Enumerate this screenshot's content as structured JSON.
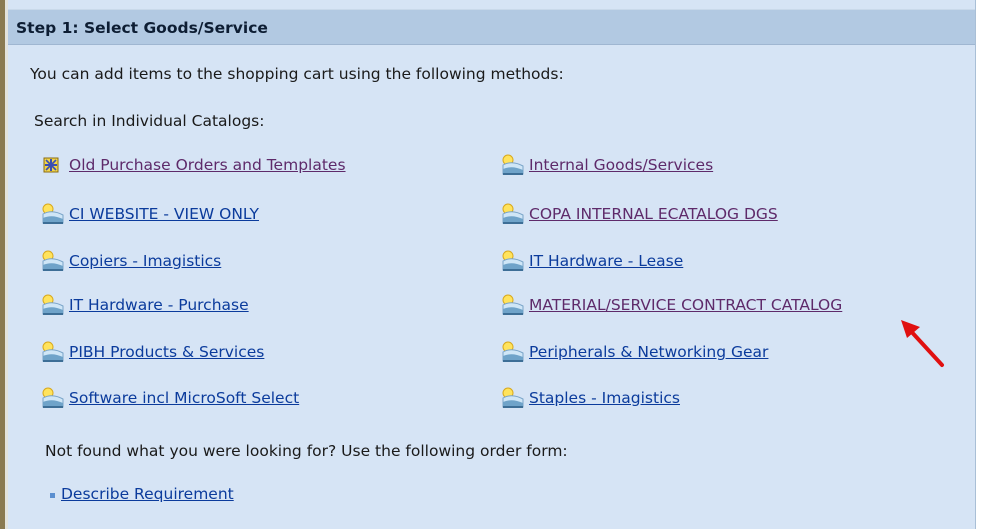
{
  "header": {
    "title": "Step 1: Select Goods/Service"
  },
  "intro_text": "You can add items to the shopping cart using the following methods:",
  "search_label": "Search in Individual Catalogs:",
  "catalogs_left": [
    {
      "label": "Old Purchase Orders and Templates",
      "icon": "templates-icon",
      "visited": true
    },
    {
      "label": "CI WEBSITE - VIEW ONLY",
      "icon": "catalog-icon",
      "visited": false
    },
    {
      "label": "Copiers - Imagistics",
      "icon": "catalog-icon",
      "visited": false
    },
    {
      "label": "IT Hardware - Purchase",
      "icon": "catalog-icon",
      "visited": false
    },
    {
      "label": "PIBH Products & Services",
      "icon": "catalog-icon",
      "visited": false
    },
    {
      "label": "Software incl MicroSoft Select",
      "icon": "catalog-icon",
      "visited": false
    }
  ],
  "catalogs_right": [
    {
      "label": "Internal Goods/Services",
      "icon": "catalog-icon",
      "visited": true
    },
    {
      "label": "COPA INTERNAL ECATALOG DGS",
      "icon": "catalog-icon",
      "visited": true
    },
    {
      "label": "IT Hardware - Lease",
      "icon": "catalog-icon",
      "visited": false
    },
    {
      "label": "MATERIAL/SERVICE CONTRACT CATALOG",
      "icon": "catalog-icon",
      "visited": true
    },
    {
      "label": "Peripherals & Networking Gear",
      "icon": "catalog-icon",
      "visited": false
    },
    {
      "label": "Staples - Imagistics",
      "icon": "catalog-icon",
      "visited": false
    }
  ],
  "not_found_text": "Not found what you were looking for? Use the following order form:",
  "describe_link": "Describe Requirement",
  "colors": {
    "panel_bg": "#d6e4f5",
    "header_bg": "#b2c9e2",
    "link": "#0b3b9c",
    "visited_link": "#5e2a6a",
    "annotation_arrow": "#e01010"
  }
}
